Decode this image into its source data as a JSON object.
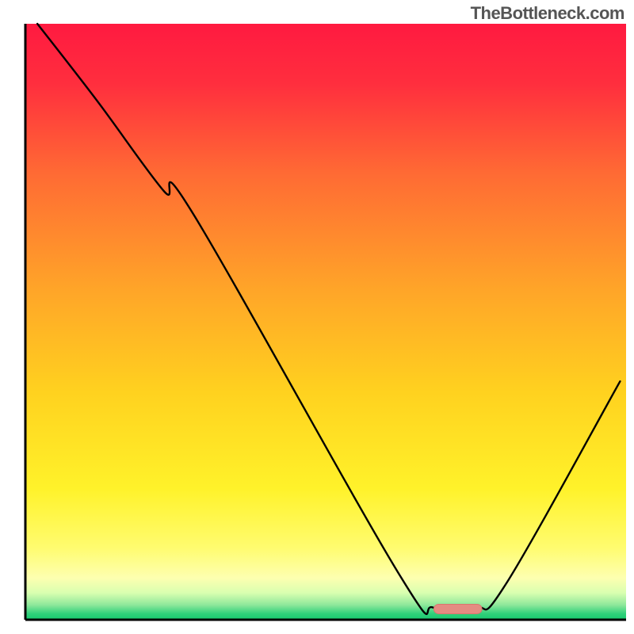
{
  "watermark": "TheBottleneck.com",
  "chart_data": {
    "type": "line",
    "title": "",
    "xlabel": "",
    "ylabel": "",
    "xlim": [
      0,
      100
    ],
    "ylim": [
      0,
      100
    ],
    "x": [
      2,
      12,
      23,
      28,
      62,
      68,
      75,
      80,
      99
    ],
    "values": [
      100,
      87,
      72,
      68,
      8,
      2,
      2,
      6,
      40
    ],
    "marker": {
      "x_start": 68,
      "x_end": 76,
      "y": 1.8
    },
    "grid": false,
    "legend": false
  },
  "plot": {
    "margin_left": 32,
    "margin_right": 10,
    "margin_top": 30,
    "margin_bottom": 18,
    "inner_w": 758,
    "inner_h": 752
  },
  "gradient_stops": [
    {
      "offset": 0.0,
      "color": "#ff1a40"
    },
    {
      "offset": 0.1,
      "color": "#ff2e3e"
    },
    {
      "offset": 0.25,
      "color": "#ff6a34"
    },
    {
      "offset": 0.45,
      "color": "#ffa628"
    },
    {
      "offset": 0.62,
      "color": "#ffd21f"
    },
    {
      "offset": 0.78,
      "color": "#fff22a"
    },
    {
      "offset": 0.88,
      "color": "#fffc70"
    },
    {
      "offset": 0.93,
      "color": "#fdffb0"
    },
    {
      "offset": 0.955,
      "color": "#d9ffb0"
    },
    {
      "offset": 0.975,
      "color": "#8fe89b"
    },
    {
      "offset": 0.99,
      "color": "#2fd07a"
    },
    {
      "offset": 1.0,
      "color": "#17c96f"
    }
  ],
  "colors": {
    "axis": "#000000",
    "curve": "#000000",
    "marker_fill": "#e58b82",
    "marker_stroke": "#d9766d"
  }
}
